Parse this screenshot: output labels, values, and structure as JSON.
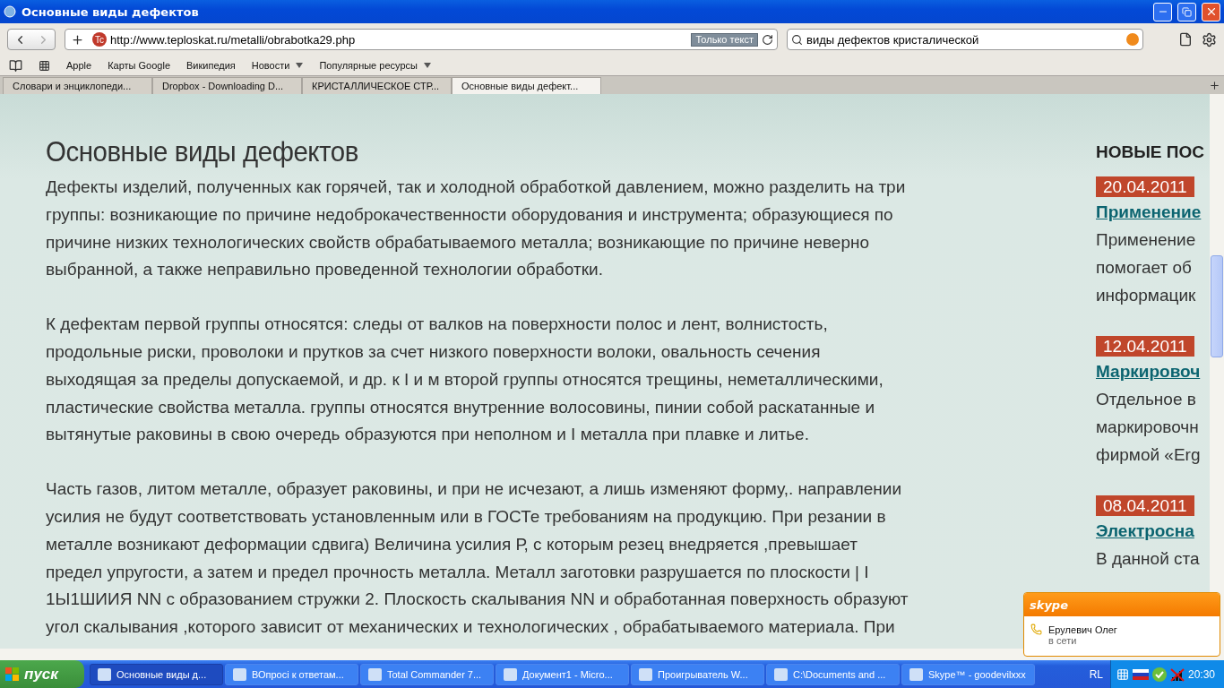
{
  "window": {
    "title": "Основные виды дефектов"
  },
  "toolbar": {
    "url": "http://www.teploskat.ru/metalli/obrabotka29.php",
    "site_badge": "Tc",
    "reader_button": "Только текст",
    "search": "виды дефектов кристалической"
  },
  "bookmarks": [
    {
      "label": "Apple",
      "menu": false
    },
    {
      "label": "Карты Google",
      "menu": false
    },
    {
      "label": "Википедия",
      "menu": false
    },
    {
      "label": "Новости",
      "menu": true
    },
    {
      "label": "Популярные ресурсы",
      "menu": true
    }
  ],
  "tabs": [
    {
      "label": "Словари и энциклопеди...",
      "selected": false
    },
    {
      "label": "Dropbox - Downloading D...",
      "selected": false
    },
    {
      "label": "КРИСТАЛЛИЧЕСКОЕ СТР...",
      "selected": false
    },
    {
      "label": "Основные виды дефект...",
      "selected": true
    }
  ],
  "article": {
    "title": "Основные виды дефектов",
    "paragraphs": [
      {
        "lines": [
          "Дефекты изделий, полученных как горячей, так и холодной обработкой давлением, можно разделить на три",
          "группы: возникающие по причине недоброкачественности оборудования и инструмента; образующиеся по",
          "причине низких технологических свойств обрабатываемого металла; возникающие по причине неверно",
          "выбранной, а также неправильно проведенной технологии обработки."
        ]
      },
      {
        "lines": [
          "К дефектам первой группы относятся: следы от валков на поверхности полос и лент, волнистость,",
          "продольные риски, проволоки и прутков за счет низкого поверхности волоки, овальность сечения",
          "выходящая за пределы допускаемой, и др. к I и м второй группы относятся трещины, неметаллическими,",
          "пластические свойства металла. группы относятся внутренние волосовины, пинии собой раскатанные и",
          "вытянутые раковины в свою очередь образуются при неполном и I металла при плавке и литье."
        ]
      },
      {
        "lines": [
          "Часть газов, литом металле, образует раковины, и при не исчезают, а лишь изменяют форму,. направлении",
          "усилия не будут соответствовать установленным или в ГОСТе требованиям на продукцию. При резании в",
          "металле возникают деформации сдвига) Величина усилия Р, с которым резец внедряется ,превышает",
          "предел упругости, а затем и предел прочность металла. Металл заготовки разрушается по плоскости | I",
          "1Ы1ШИИЯ NN с образованием стружки 2. Плоскость скалывания NN и обработанная поверхность образуют",
          "угол скалывания ,которого зависит от механических и технологических , обрабатываемого материала. При"
        ]
      }
    ]
  },
  "sidebar": {
    "heading": "НОВЫЕ ПОС",
    "posts": [
      {
        "date": "20.04.2011",
        "title": "Применение",
        "excerpt": [
          "Применение",
          "помогает об",
          "информацик"
        ]
      },
      {
        "date": "12.04.2011",
        "title": "Маркировоч",
        "excerpt": [
          "Отдельное в",
          "маркировочн",
          "фирмой «Erg"
        ]
      },
      {
        "date": "08.04.2011",
        "title": "Электросна",
        "excerpt": [
          "В данной ста"
        ]
      }
    ]
  },
  "skype_popup": {
    "brand": "skype",
    "name": "Ерулевич Олег",
    "status": "в сети"
  },
  "taskbar": {
    "start": "пуск",
    "tasks": [
      {
        "label": "Основные виды д...",
        "selected": true
      },
      {
        "label": "ВОпросі к ответам...",
        "selected": false
      },
      {
        "label": "Total Commander 7...",
        "selected": false
      },
      {
        "label": "Документ1 - Micro...",
        "selected": false
      },
      {
        "label": "Проигрыватель W...",
        "selected": false
      },
      {
        "label": "C:\\Documents and ...",
        "selected": false
      },
      {
        "label": "Skype™ - goodevilxxx",
        "selected": false
      }
    ],
    "language": "RL",
    "clock": "20:30"
  }
}
